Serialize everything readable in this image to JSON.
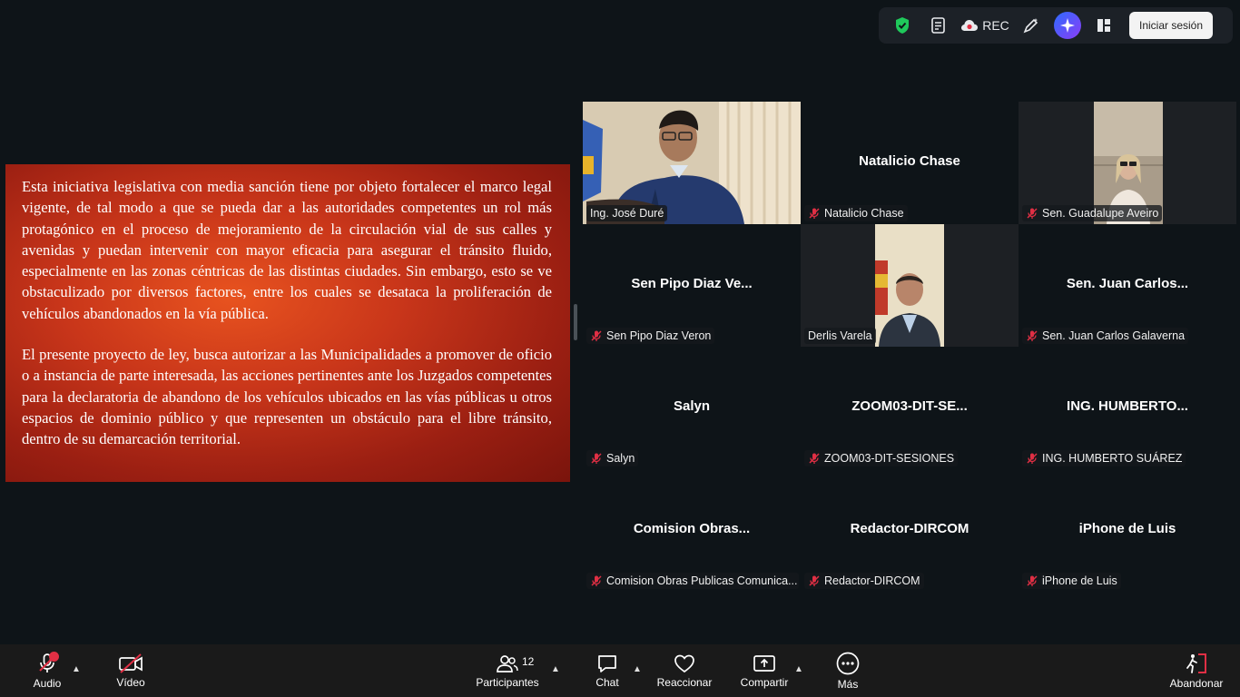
{
  "toolbar": {
    "rec_label": "REC",
    "signin_label": "Iniciar sesión",
    "icons": [
      "shield-check-icon",
      "notes-icon",
      "cloud-record-icon",
      "annotate-icon",
      "ai-companion-icon",
      "layout-icon"
    ]
  },
  "slide": {
    "paragraph1": "Esta iniciativa legislativa con media sanción tiene por objeto fortalecer el marco legal vigente, de tal modo a que se pueda dar a las autoridades competentes un rol más protagónico en el proceso de mejoramiento de la circulación vial de sus calles y avenidas y puedan intervenir con mayor eficacia para asegurar el tránsito fluido, especialmente en las zonas céntricas de las distintas ciudades. Sin embargo, esto se ve obstaculizado por diversos factores, entre los cuales se desataca la proliferación de vehículos abandonados en la vía pública.",
    "paragraph2": "El presente proyecto de ley, busca autorizar a las Municipalidades a promover de oficio o a instancia de parte interesada, las acciones pertinentes ante los Juzgados competentes para la declaratoria de abandono de los vehículos ubicados en las vías públicas u otros espacios de dominio público y que representen un obstáculo para el libre tránsito, dentro de su demarcación territorial."
  },
  "participants": [
    {
      "title": "",
      "name": "Ing. José Duré",
      "video": true,
      "muted": false,
      "active": true
    },
    {
      "title": "Natalicio Chase",
      "name": "Natalicio Chase",
      "video": false,
      "muted": true,
      "active": false
    },
    {
      "title": "",
      "name": "Sen. Guadalupe Aveiro",
      "video": true,
      "muted": true,
      "active": false
    },
    {
      "title": "Sen Pipo Diaz Ve...",
      "name": "Sen Pipo Diaz Veron",
      "video": false,
      "muted": true,
      "active": false
    },
    {
      "title": "",
      "name": "Derlis Varela",
      "video": true,
      "muted": false,
      "active": false
    },
    {
      "title": "Sen. Juan Carlos...",
      "name": "Sen. Juan Carlos Galaverna",
      "video": false,
      "muted": true,
      "active": false
    },
    {
      "title": "Salyn",
      "name": "Salyn",
      "video": false,
      "muted": true,
      "active": false
    },
    {
      "title": "ZOOM03-DIT-SE...",
      "name": "ZOOM03-DIT-SESIONES",
      "video": false,
      "muted": true,
      "active": false
    },
    {
      "title": "ING. HUMBERTO...",
      "name": "ING. HUMBERTO SUÁREZ",
      "video": false,
      "muted": true,
      "active": false
    },
    {
      "title": "Comision Obras...",
      "name": "Comision Obras Publicas Comunica...",
      "video": false,
      "muted": true,
      "active": false
    },
    {
      "title": "Redactor-DIRCOM",
      "name": "Redactor-DIRCOM",
      "video": false,
      "muted": true,
      "active": false
    },
    {
      "title": "iPhone de Luis",
      "name": "iPhone de Luis",
      "video": false,
      "muted": true,
      "active": false
    }
  ],
  "bottombar": {
    "audio_label": "Audio",
    "video_label": "Vídeo",
    "participants_label": "Participantes",
    "participants_count": "12",
    "chat_label": "Chat",
    "react_label": "Reaccionar",
    "share_label": "Compartir",
    "more_label": "Más",
    "leave_label": "Abandonar"
  },
  "colors": {
    "active_speaker": "#2bd17e",
    "mute_red": "#e02f44",
    "slide_red": "#c9361a"
  }
}
